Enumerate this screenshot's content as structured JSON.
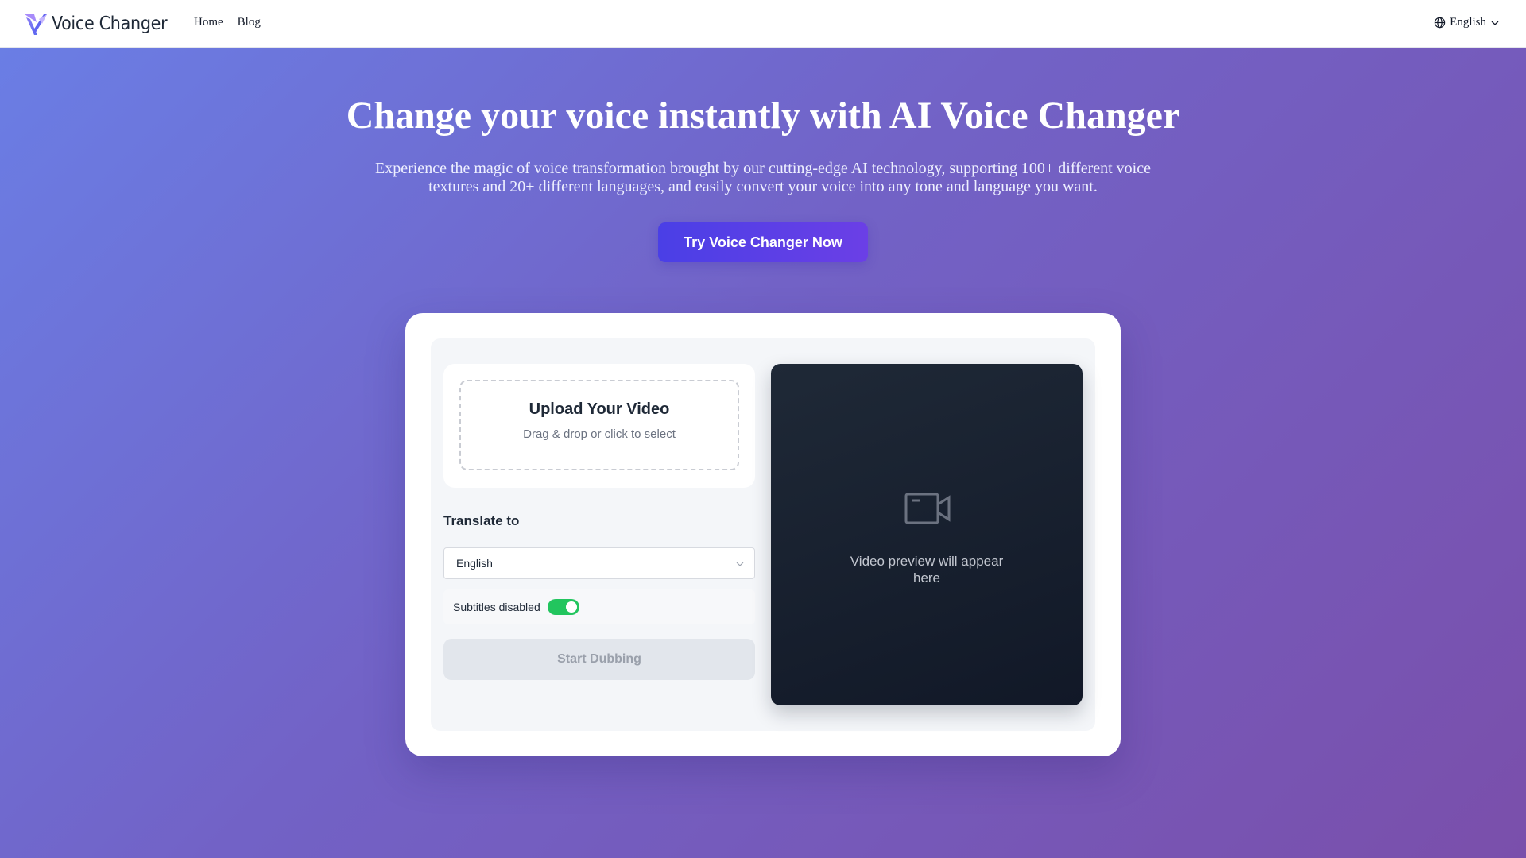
{
  "header": {
    "logo_text": "Voice Changer",
    "nav": [
      "Home",
      "Blog"
    ],
    "language": "English"
  },
  "hero": {
    "title": "Change your voice instantly with AI Voice Changer",
    "subtitle": "Experience the magic of voice transformation brought by our cutting-edge AI technology, supporting 100+ different voice textures and 20+ different languages, and easily convert your voice into any tone and language you want.",
    "cta_label": "Try Voice Changer Now"
  },
  "upload": {
    "title": "Upload Your Video",
    "hint": "Drag & drop or click to select"
  },
  "translate": {
    "label": "Translate to",
    "selected": "English"
  },
  "subtitles": {
    "label": "Subtitles disabled",
    "toggle_on": true
  },
  "dub_button": "Start Dubbing",
  "preview": {
    "text": "Video preview will appear here"
  },
  "colors": {
    "accent": "#4f46e5",
    "toggle": "#22c55e",
    "preview_bg": "#1a2230"
  },
  "icons": {
    "logo": "logo-mark-icon",
    "language": "globe-icon",
    "dropdown": "chevron-down-icon",
    "preview": "video-camera-icon"
  }
}
